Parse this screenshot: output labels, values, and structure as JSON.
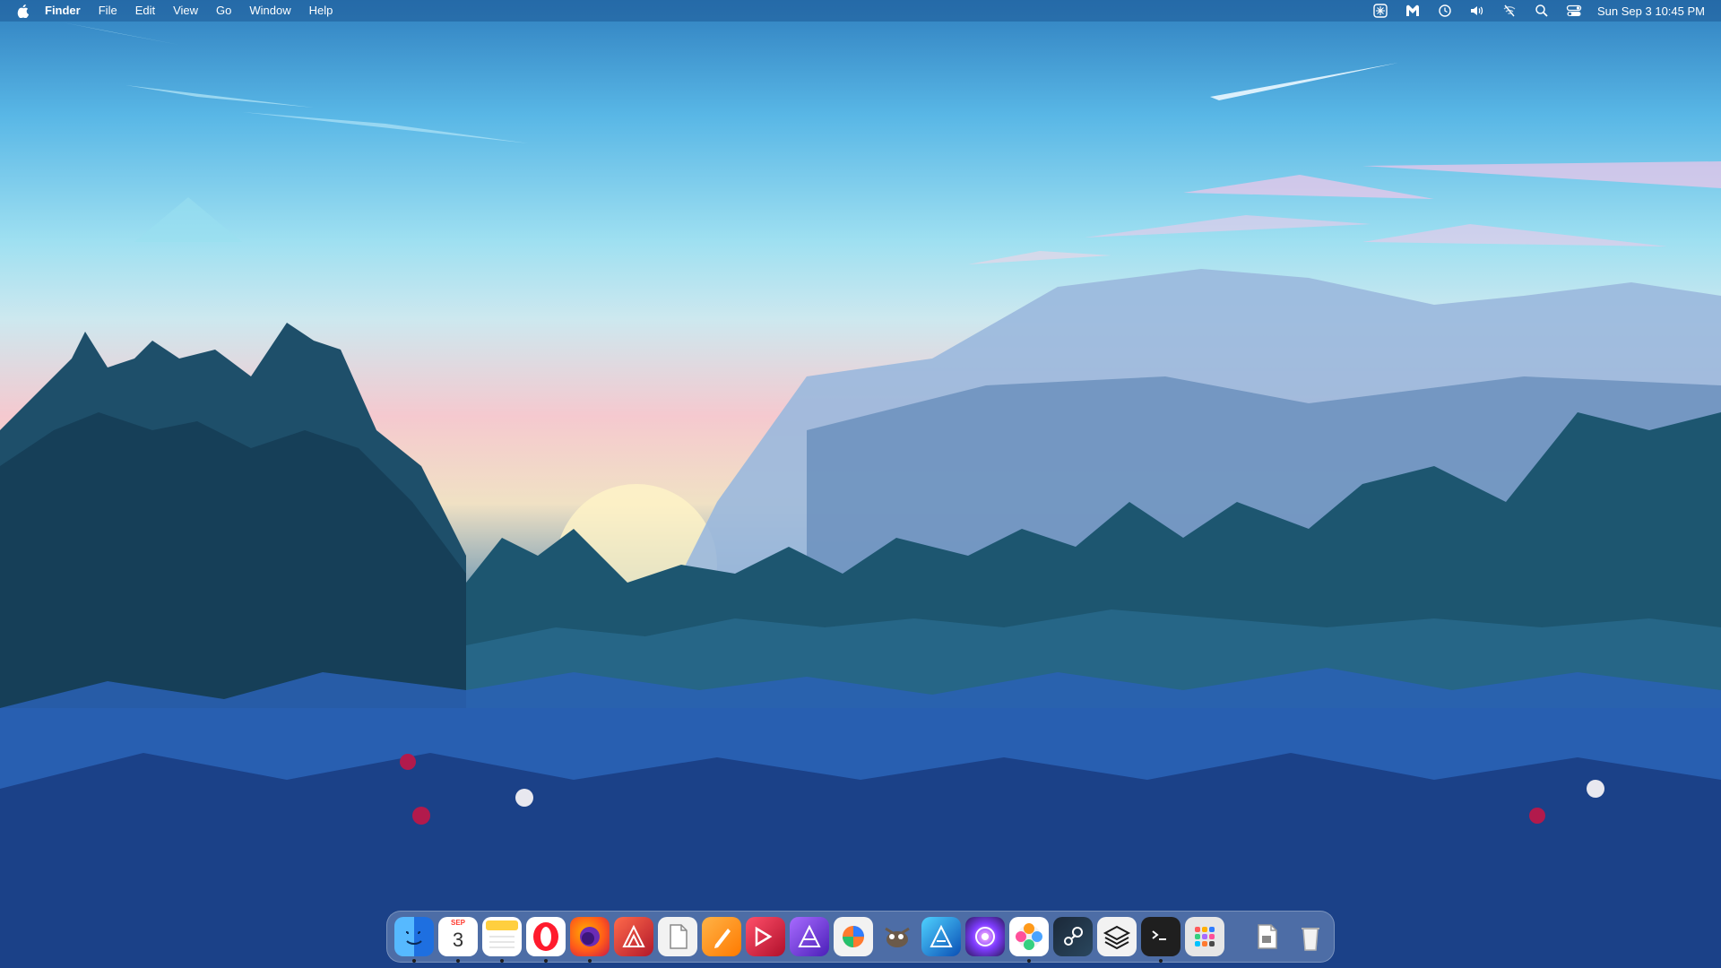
{
  "menubar": {
    "apple_icon": "apple-icon",
    "app_name": "Finder",
    "menus": [
      "File",
      "Edit",
      "View",
      "Go",
      "Window",
      "Help"
    ],
    "status_icons": [
      "snowflake-icon",
      "malwarebytes-icon",
      "time-machine-icon",
      "volume-icon",
      "wifi-off-icon",
      "spotlight-search-icon",
      "control-center-icon"
    ],
    "clock": "Sun Sep 3  10:45 PM"
  },
  "dock": {
    "apps": [
      {
        "name": "finder",
        "icon": "finder-icon",
        "color": "#2f8df4",
        "running": true
      },
      {
        "name": "calendar",
        "icon": "calendar-icon",
        "month": "SEP",
        "day": "3",
        "color": "#ffffff",
        "running": true
      },
      {
        "name": "notes",
        "icon": "notes-icon",
        "color": "#ffd54a",
        "running": true
      },
      {
        "name": "opera",
        "icon": "opera-icon",
        "color": "#ff1b2d",
        "running": true
      },
      {
        "name": "firefox",
        "icon": "firefox-icon",
        "color": "#ff7a1a",
        "running": true
      },
      {
        "name": "affinity-publisher",
        "icon": "affinity-publisher-icon",
        "color": "#e2432d",
        "running": false
      },
      {
        "name": "textedit",
        "icon": "textedit-icon",
        "color": "#f2f2f2",
        "running": false
      },
      {
        "name": "pages",
        "icon": "pages-icon",
        "color": "#ff9b1a",
        "running": false
      },
      {
        "name": "pdf-expert",
        "icon": "pdf-expert-icon",
        "color": "#e0303e",
        "running": false
      },
      {
        "name": "affinity-photo",
        "icon": "affinity-photo-icon",
        "color": "#7b3fe4",
        "running": false
      },
      {
        "name": "pixelmator",
        "icon": "pixelmator-icon",
        "color": "#e8e8e8",
        "running": false
      },
      {
        "name": "gimp",
        "icon": "gimp-icon",
        "color": "#9b9b9b",
        "running": false
      },
      {
        "name": "affinity-designer",
        "icon": "affinity-designer-icon",
        "color": "#1b7cd6",
        "running": false
      },
      {
        "name": "davinci-resolve",
        "icon": "davinci-resolve-icon",
        "color": "#6a3fd4",
        "running": false
      },
      {
        "name": "photos",
        "icon": "photos-icon",
        "color": "#ffffff",
        "running": true
      },
      {
        "name": "steam",
        "icon": "steam-icon",
        "color": "#1b2838",
        "running": false
      },
      {
        "name": "parallels",
        "icon": "parallels-layers-icon",
        "color": "#1a1a1a",
        "running": false
      },
      {
        "name": "terminal",
        "icon": "terminal-icon",
        "color": "#1f1f1f",
        "running": true
      },
      {
        "name": "launchpad",
        "icon": "launchpad-icon",
        "color": "#d9d9d9",
        "running": false
      }
    ],
    "others": [
      {
        "name": "documents",
        "icon": "document-folder-icon",
        "color": "#f2f2f2"
      },
      {
        "name": "trash",
        "icon": "trash-icon",
        "color": "#e6e6e6"
      }
    ]
  }
}
